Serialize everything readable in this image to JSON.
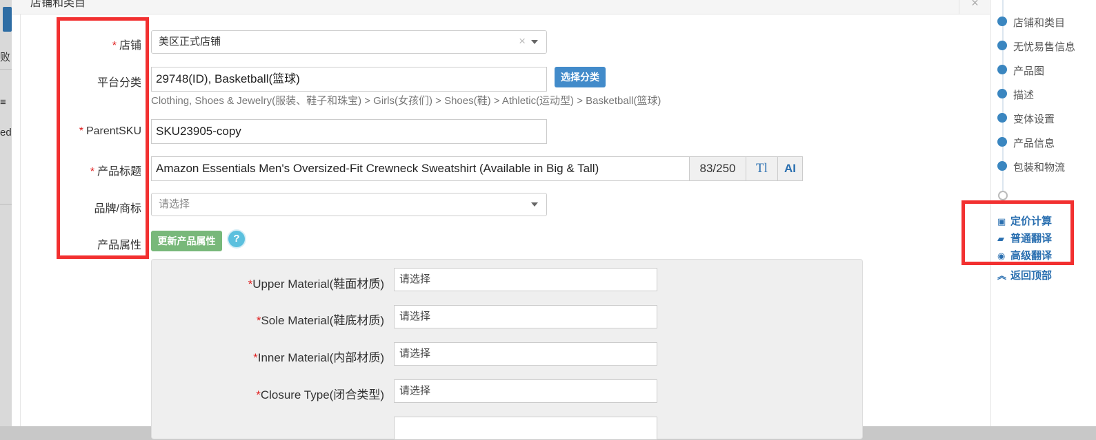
{
  "background_app": {
    "text_1": "败",
    "text_2": "≡",
    "text_3": "ed"
  },
  "modal": {
    "title": "店铺和类目",
    "close_glyph": "×"
  },
  "form": {
    "required_mark": "*",
    "store": {
      "label": "店铺",
      "value": "美区正式店铺",
      "clear_glyph": "×"
    },
    "category": {
      "label": "平台分类",
      "value": "29748(ID), Basketball(篮球)",
      "button": "选择分类",
      "path": "Clothing, Shoes & Jewelry(服装、鞋子和珠宝) > Girls(女孩们) > Shoes(鞋) > Athletic(运动型) > Basketball(篮球)"
    },
    "parent_sku": {
      "label": "ParentSKU",
      "value": "SKU23905-copy"
    },
    "title": {
      "label": "产品标题",
      "value": "Amazon Essentials Men's Oversized-Fit Crewneck Sweatshirt (Available in Big & Tall)",
      "counter": "83/250",
      "tt_button": "Tl",
      "ai_button": "AI"
    },
    "brand": {
      "label": "品牌/商标",
      "placeholder": "请选择"
    },
    "attributes": {
      "label": "产品属性",
      "update_button": "更新产品属性",
      "help_glyph": "?"
    }
  },
  "attribute_fields": [
    {
      "label": "Upper Material(鞋面材质)",
      "placeholder": "请选择"
    },
    {
      "label": "Sole Material(鞋底材质)",
      "placeholder": "请选择"
    },
    {
      "label": "Inner Material(内部材质)",
      "placeholder": "请选择"
    },
    {
      "label": "Closure Type(闭合类型)",
      "placeholder": "请选择"
    }
  ],
  "side_nav": {
    "items": [
      {
        "label": "店铺和类目"
      },
      {
        "label": "无忧易售信息"
      },
      {
        "label": "产品图"
      },
      {
        "label": "描述"
      },
      {
        "label": "变体设置"
      },
      {
        "label": "产品信息"
      },
      {
        "label": "包装和物流"
      }
    ],
    "tools": [
      {
        "label": "定价计算",
        "icon": "calculator-icon",
        "glyph": "▣"
      },
      {
        "label": "普通翻译",
        "icon": "book-icon",
        "glyph": "▰"
      },
      {
        "label": "高级翻译",
        "icon": "chat-icon",
        "glyph": "◉"
      },
      {
        "label": "返回顶部",
        "icon": "chevrons-up-icon",
        "glyph": "︽"
      }
    ]
  },
  "colors": {
    "highlight": "#f23030",
    "primary": "#428bca",
    "success": "#78b87a",
    "nav_dot": "#3a86c0",
    "required": "#e02020"
  }
}
